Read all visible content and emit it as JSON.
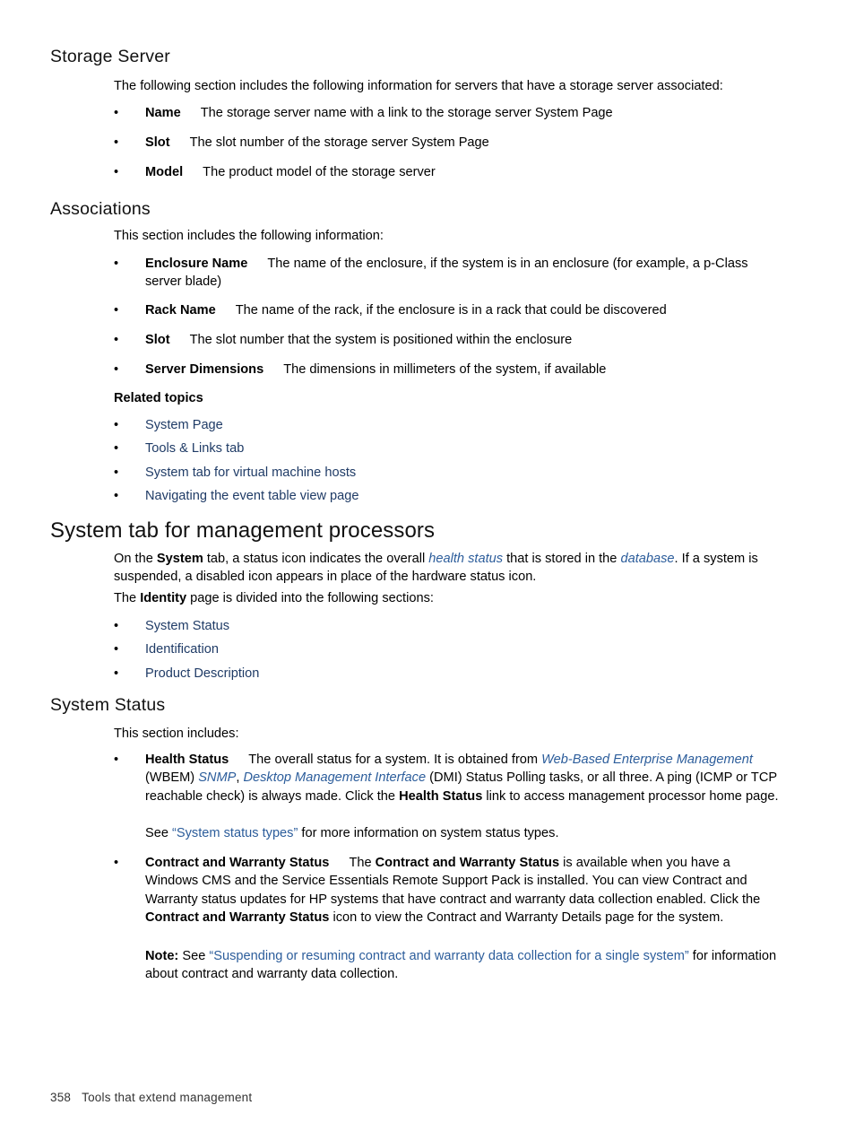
{
  "document": {
    "footer": {
      "page_number": "358",
      "chapter_title": "Tools that extend management"
    }
  },
  "sections": {
    "storage_server": {
      "heading": "Storage Server",
      "intro": "The following section includes the following information for servers that have a storage server associated:",
      "bullets": [
        {
          "term": "Name",
          "desc": "The storage server name with a link to the storage server System Page"
        },
        {
          "term": "Slot",
          "desc": "The slot number of the storage server System Page"
        },
        {
          "term": "Model",
          "desc": "The product model of the storage server"
        }
      ]
    },
    "associations": {
      "heading": "Associations",
      "intro": "This section includes the following information:",
      "bullets": [
        {
          "term": "Enclosure Name",
          "desc": "The name of the enclosure, if the system is in an enclosure (for example, a p-Class server blade)"
        },
        {
          "term": "Rack Name",
          "desc": "The name of the rack, if the enclosure is in a rack that could be discovered"
        },
        {
          "term": "Slot",
          "desc": "The slot number that the system is positioned within the enclosure"
        },
        {
          "term": "Server Dimensions",
          "desc": "The dimensions in millimeters of the system, if available"
        }
      ],
      "related_topics_heading": "Related topics",
      "related_topics": [
        "System Page",
        "Tools & Links tab",
        "System tab for virtual machine hosts",
        "Navigating the event table view page"
      ]
    },
    "system_tab_mp": {
      "heading": "System tab for management processors",
      "intro_1": "On the ",
      "intro_1_b1": "System",
      "intro_1_t2": " tab, a status icon indicates the overall ",
      "intro_1_link1": "health status",
      "intro_1_t3": " that is stored in the ",
      "intro_1_link2": "database",
      "intro_1_t4": ". If a system is suspended, a disabled icon appears in place of the hardware status icon.",
      "intro_2_t1": "The ",
      "intro_2_b1": "Identity",
      "intro_2_t2": " page is divided into the following sections:",
      "links": [
        "System Status",
        "Identification",
        "Product Description"
      ]
    },
    "system_status": {
      "heading": "System Status",
      "intro": "This section includes:",
      "health_status": {
        "term": "Health Status",
        "t1": "The overall status for a system. It is obtained from ",
        "link1": "Web-Based Enterprise Management",
        "t2": " (WBEM) ",
        "link2": "SNMP",
        "t3": ", ",
        "link3": "Desktop Management Interface",
        "t4": " (DMI) Status Polling tasks, or all three. A ping (ICMP or TCP reachable check) is always made. Click the ",
        "b1": "Health Status",
        "t5": " link to access management processor home page.",
        "see_t1": "See ",
        "see_link": "“System status types”",
        "see_t2": " for more information on system status types."
      },
      "contract_warranty": {
        "term": "Contract and Warranty Status",
        "t1": "The ",
        "b1": "Contract and Warranty Status",
        "t2": " is available when you have a Windows CMS and the Service Essentials Remote Support Pack is installed. You can view Contract and Warranty status updates for HP systems that have contract and warranty data collection enabled. Click the ",
        "b2": "Contract and Warranty Status",
        "t3": " icon to view the Contract and Warranty Details page for the system.",
        "note_label": "Note:",
        "note_t1": " See ",
        "note_link": "“Suspending or resuming contract and warranty data collection for a single system”",
        "note_t2": " for information about contract and warranty data collection."
      }
    }
  },
  "icons": {
    "bullet": "•"
  },
  "colors": {
    "text": "#000000",
    "link_navy": "#1f3b66",
    "link_blue": "#2c5d9b",
    "heading": "#111111"
  }
}
